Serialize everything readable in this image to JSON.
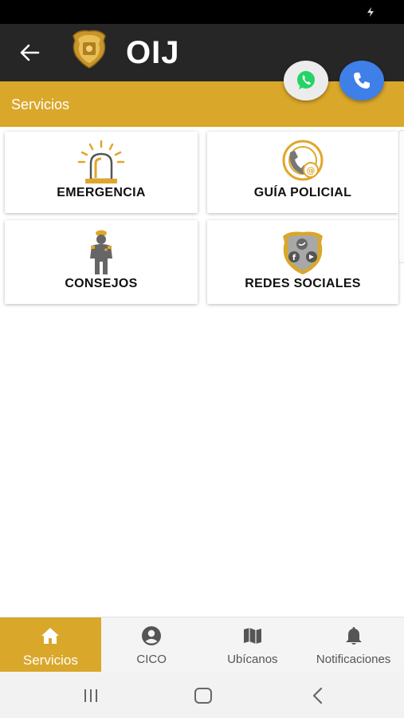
{
  "app": {
    "title": "OIJ"
  },
  "section": {
    "title": "Servicios"
  },
  "services": [
    {
      "label": "EMERGENCIA",
      "icon": "siren-icon"
    },
    {
      "label": "GUÍA POLICIAL",
      "icon": "phone-contact-icon"
    },
    {
      "label": "CONSEJOS",
      "icon": "officer-icon"
    },
    {
      "label": "REDES SOCIALES",
      "icon": "social-badge-icon"
    }
  ],
  "fabs": {
    "whatsapp": "whatsapp-icon",
    "call": "phone-icon"
  },
  "bottom_nav": [
    {
      "label": "Servicios",
      "icon": "home-icon",
      "active": true
    },
    {
      "label": "CICO",
      "icon": "account-circle-icon",
      "active": false
    },
    {
      "label": "Ubícanos",
      "icon": "map-icon",
      "active": false
    },
    {
      "label": "Notificaciones",
      "icon": "bell-icon",
      "active": false
    }
  ],
  "colors": {
    "accent": "#d9a72a",
    "appbar": "#262626",
    "call": "#3f7fe8",
    "whatsapp": "#25d366"
  }
}
